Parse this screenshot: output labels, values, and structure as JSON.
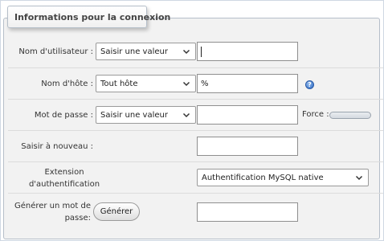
{
  "legend": "Informations pour la connexion",
  "rows": {
    "username": {
      "label": "Nom d'utilisateur :",
      "select": "Saisir une valeur",
      "value": ""
    },
    "host": {
      "label": "Nom d'hôte :",
      "select": "Tout hôte",
      "value": "%"
    },
    "password": {
      "label": "Mot de passe :",
      "select": "Saisir une valeur",
      "value": "",
      "strength_label": "Force :",
      "strength": 0
    },
    "retype": {
      "label": "Saisir à nouveau :",
      "value": ""
    },
    "auth": {
      "label": "Extension d'authentification",
      "select": "Authentification MySQL native"
    },
    "generate": {
      "label": "Générer un mot de passe:",
      "button": "Générer",
      "value": ""
    }
  },
  "colors": {
    "panel_bg": "#f2f2f2",
    "help_icon": "#2e6bc4"
  },
  "icons": [
    "chevron-down-icon",
    "help-icon"
  ]
}
